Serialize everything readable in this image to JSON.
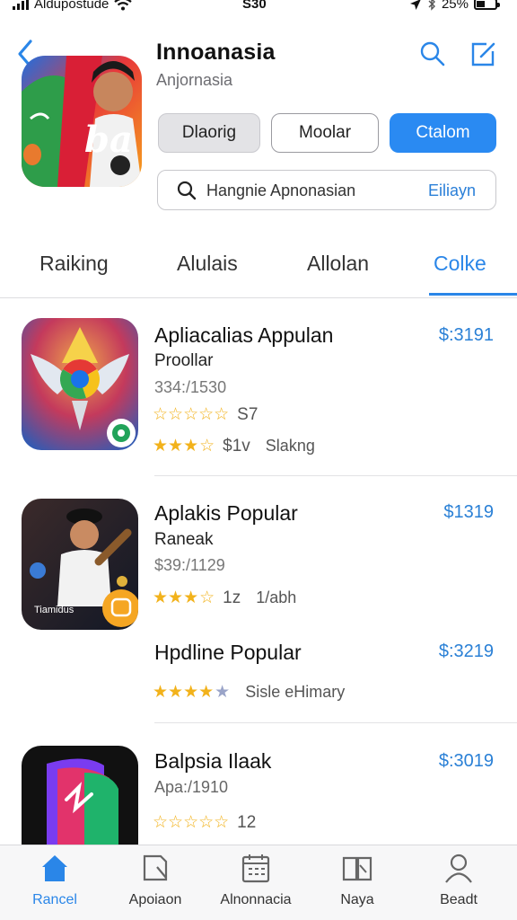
{
  "status_bar": {
    "carrier": "Aldupostude",
    "time": "S30",
    "battery": "25%"
  },
  "header": {
    "title": "Innoanasia",
    "subtitle": "Anjornasia",
    "icon_text": "ba",
    "segments": [
      "Dlaorig",
      "Moolar",
      "Ctalom"
    ],
    "search": {
      "placeholder": "Hangnie Apnonasian",
      "action": "Eiliayn"
    }
  },
  "tabs": [
    "Raiking",
    "Alulais",
    "Allolan",
    "Colke"
  ],
  "active_tab": 3,
  "apps": [
    {
      "title": "Apliacalias Appulan",
      "subtitle": "Proollar",
      "meta": "334:/1530",
      "price": "$:3191",
      "rating_1": {
        "stars": 5,
        "label": "S7"
      },
      "rating_2": {
        "stars": 3.5,
        "label": "$1v",
        "extra": "Slakng"
      }
    },
    {
      "title": "Aplakis Popular",
      "subtitle": "Raneak",
      "meta": "$39:/1129",
      "price": "$1319",
      "rating_1": {
        "stars": 3.5,
        "label": "1z",
        "extra": "1/abh"
      }
    },
    {
      "title": "Hpdline Popular",
      "price": "$:3219",
      "rating_1": {
        "stars": 4.5,
        "extra": "Sisle eHimary"
      }
    },
    {
      "title": "Balpsia Ilaak",
      "meta": "Apa:/1910",
      "price": "$:3019",
      "rating_1": {
        "stars": 5,
        "label": "12"
      }
    }
  ],
  "tab_bar": [
    "Rancel",
    "Apoiaon",
    "Alnonnacia",
    "Naya",
    "Beadt"
  ],
  "tab_bar_active": 0,
  "icon_overlay_text": "Tiamidus",
  "colors": {
    "accent": "#2a86e8",
    "star": "#f2b21b",
    "price": "#2a80d6"
  }
}
